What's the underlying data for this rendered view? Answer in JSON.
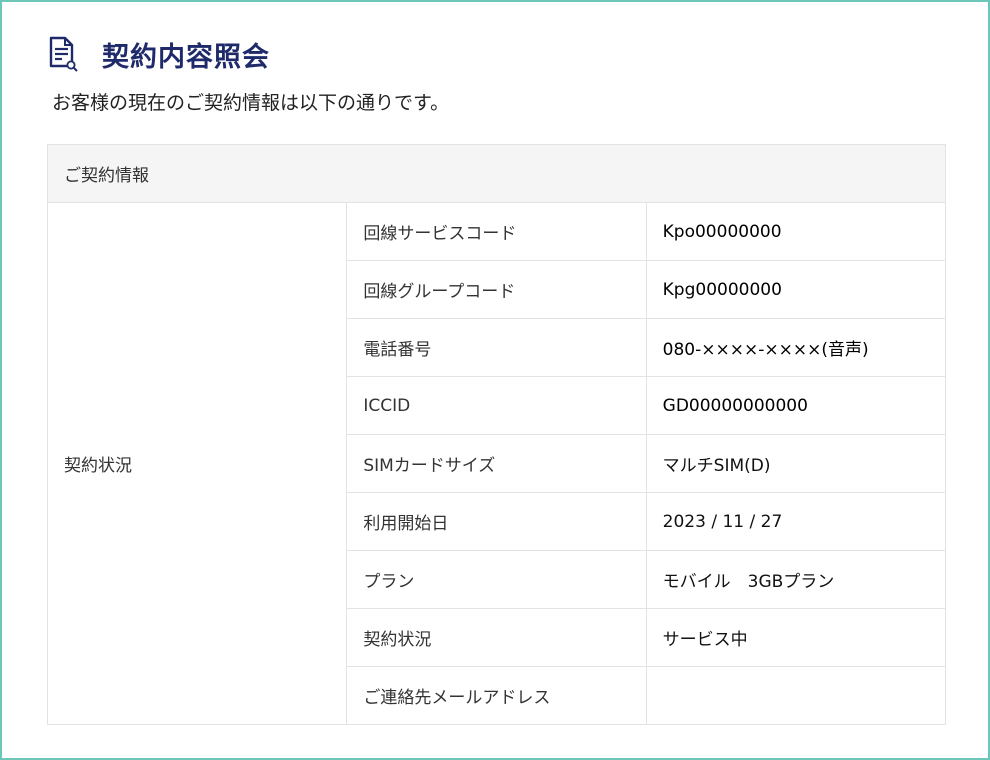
{
  "page": {
    "title": "契約内容照会",
    "description": "お客様の現在のご契約情報は以下の通りです。"
  },
  "table": {
    "section_header": "ご契約情報",
    "group_label": "契約状況",
    "rows": [
      {
        "label": "回線サービスコード",
        "value": "Kpo00000000"
      },
      {
        "label": "回線グループコード",
        "value": "Kpg00000000"
      },
      {
        "label": "電話番号",
        "value": "080-××××-××××(音声)"
      },
      {
        "label": "ICCID",
        "value": "GD00000000000"
      },
      {
        "label": "SIMカードサイズ",
        "value": "マルチSIM(D)"
      },
      {
        "label": "利用開始日",
        "value": "2023 / 11 / 27"
      },
      {
        "label": "プラン",
        "value": "モバイル　3GBプラン"
      },
      {
        "label": "契約状況",
        "value": "サービス中"
      },
      {
        "label": "ご連絡先メールアドレス",
        "value": ""
      }
    ]
  },
  "colors": {
    "frame_border": "#6cc7b8",
    "title": "#1f2a6b",
    "header_bg": "#f5f5f5"
  },
  "icons": {
    "title_icon": "document-search-icon"
  }
}
